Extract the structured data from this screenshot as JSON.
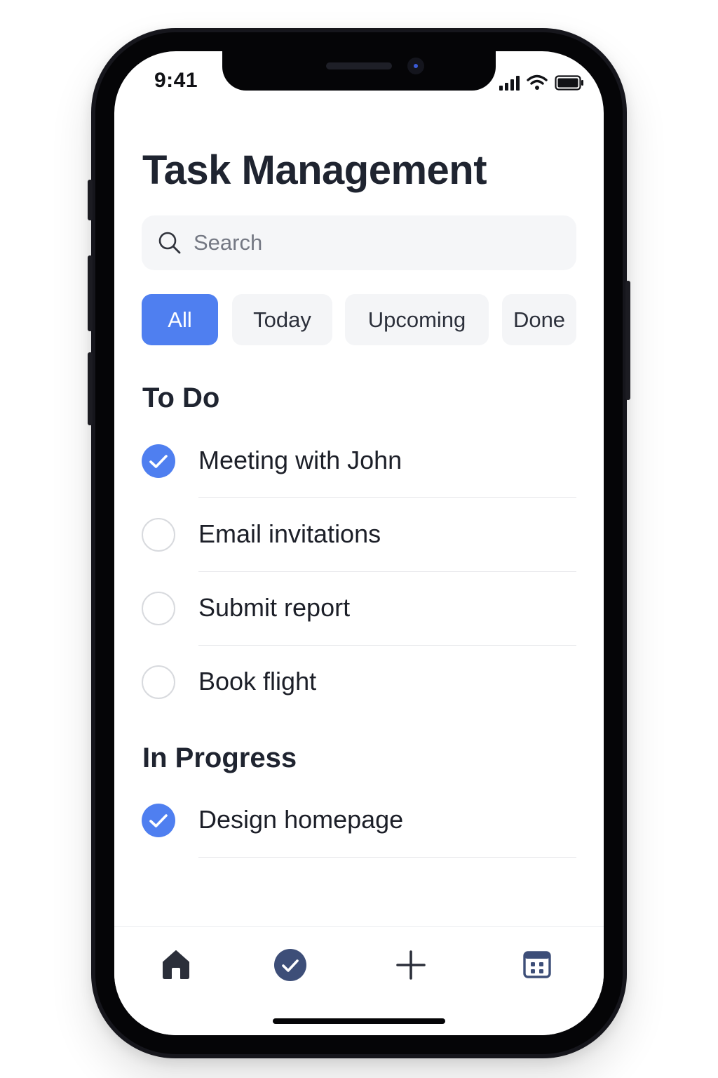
{
  "status_bar": {
    "time": "9:41"
  },
  "page": {
    "title": "Task Management"
  },
  "search": {
    "placeholder": "Search",
    "value": ""
  },
  "filters": {
    "tabs": [
      {
        "label": "All",
        "active": true
      },
      {
        "label": "Today",
        "active": false
      },
      {
        "label": "Upcoming",
        "active": false
      },
      {
        "label": "Done",
        "active": false
      }
    ]
  },
  "sections": [
    {
      "title": "To Do",
      "tasks": [
        {
          "label": "Meeting with John",
          "completed": true
        },
        {
          "label": "Email invitations",
          "completed": false
        },
        {
          "label": "Submit report",
          "completed": false
        },
        {
          "label": "Book flight",
          "completed": false
        }
      ]
    },
    {
      "title": "In Progress",
      "tasks": [
        {
          "label": "Design homepage",
          "completed": true
        }
      ]
    }
  ],
  "bottom_nav": {
    "items": [
      {
        "icon": "home-icon"
      },
      {
        "icon": "check-circle-icon"
      },
      {
        "icon": "plus-icon"
      },
      {
        "icon": "calendar-icon"
      }
    ]
  },
  "colors": {
    "accent": "#4f7ff0",
    "nav_active": "#3d4e78",
    "text_primary": "#1f2430",
    "chip_background": "#f4f5f7"
  }
}
